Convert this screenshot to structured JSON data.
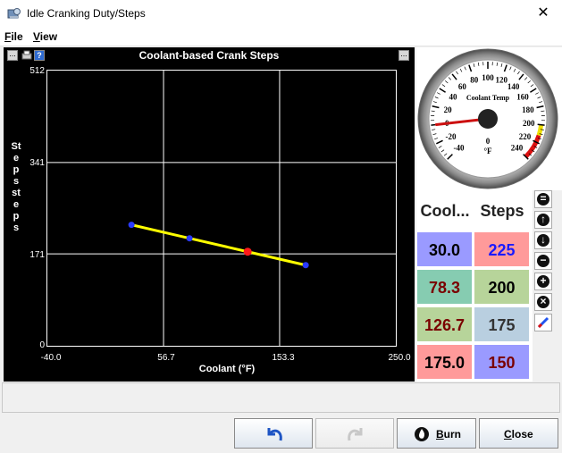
{
  "window": {
    "title": "Idle Cranking Duty/Steps",
    "close_glyph": "✕"
  },
  "menu": {
    "file": "File",
    "file_mnemonic": "F",
    "file_rest": "ile",
    "view": "View",
    "view_mnemonic": "V",
    "view_rest": "iew"
  },
  "chart": {
    "title": "Coolant-based Crank Steps",
    "top_button_glyph": "...",
    "help_glyph": "?",
    "ylabel": "Steps steps",
    "xlabel": "Coolant (°F)",
    "yticks": [
      "512",
      "341",
      "171",
      "0"
    ],
    "xticks": [
      "-40.0",
      "56.7",
      "153.3",
      "250.0"
    ]
  },
  "chart_data": {
    "type": "line",
    "title": "Coolant-based Crank Steps",
    "xlabel": "Coolant (°F)",
    "ylabel": "Steps steps",
    "xlim": [
      -40.0,
      250.0
    ],
    "ylim": [
      0,
      512
    ],
    "grid": true,
    "series": [
      {
        "x": [
          30.0,
          78.3,
          126.7,
          175.0
        ],
        "y": [
          225,
          200,
          175,
          150
        ]
      }
    ],
    "selected_index": 2,
    "colors": {
      "line": "#ffff00",
      "point": "#2a3bff",
      "selected_point": "#ff1a1a",
      "grid": "#ffffff",
      "background": "#000000"
    }
  },
  "gauge": {
    "title": "Coolant Temp",
    "unit": "°F",
    "value": 0,
    "min": -40,
    "max": 240,
    "labels": [
      "-40",
      "-20",
      "0",
      "20",
      "40",
      "60",
      "80",
      "100",
      "120",
      "140",
      "160",
      "180",
      "200",
      "220",
      "240"
    ]
  },
  "table": {
    "headers": [
      "Cool...",
      "Steps"
    ],
    "rows": [
      {
        "coolant": "30.0",
        "steps": "225",
        "coolant_bg": "#9a9aff",
        "coolant_fg": "#000000",
        "steps_bg": "#ff9a9a",
        "steps_fg": "#1a1aff"
      },
      {
        "coolant": "78.3",
        "steps": "200",
        "coolant_bg": "#86ccb1",
        "coolant_fg": "#7a0000",
        "steps_bg": "#b7d49a",
        "steps_fg": "#000000"
      },
      {
        "coolant": "126.7",
        "steps": "175",
        "coolant_bg": "#b7d49a",
        "coolant_fg": "#7a0000",
        "steps_bg": "#b9cfe0",
        "steps_fg": "#333333"
      },
      {
        "coolant": "175.0",
        "steps": "150",
        "coolant_bg": "#ff9a9a",
        "coolant_fg": "#000000",
        "steps_bg": "#9a9aff",
        "steps_fg": "#7a0000"
      }
    ]
  },
  "side_buttons": [
    {
      "name": "equals-button",
      "icon": "equals-icon",
      "glyph": "="
    },
    {
      "name": "move-up-button",
      "icon": "arrow-up-icon",
      "glyph": "↑"
    },
    {
      "name": "move-down-button",
      "icon": "arrow-down-icon",
      "glyph": "↓"
    },
    {
      "name": "decrement-button",
      "icon": "minus-icon",
      "glyph": "−"
    },
    {
      "name": "increment-button",
      "icon": "plus-icon",
      "glyph": "+"
    },
    {
      "name": "cancel-button",
      "icon": "x-circle-icon",
      "glyph": "×"
    },
    {
      "name": "edit-button",
      "icon": "pencil-icon",
      "glyph": ""
    }
  ],
  "buttons": {
    "undo": {
      "icon": "undo-icon"
    },
    "redo": {
      "icon": "redo-icon"
    },
    "burn": {
      "label": "Burn",
      "mnemonic": "B",
      "rest": "urn",
      "icon": "flame-icon"
    },
    "close": {
      "label": "Close",
      "mnemonic": "C",
      "rest": "lose"
    }
  }
}
